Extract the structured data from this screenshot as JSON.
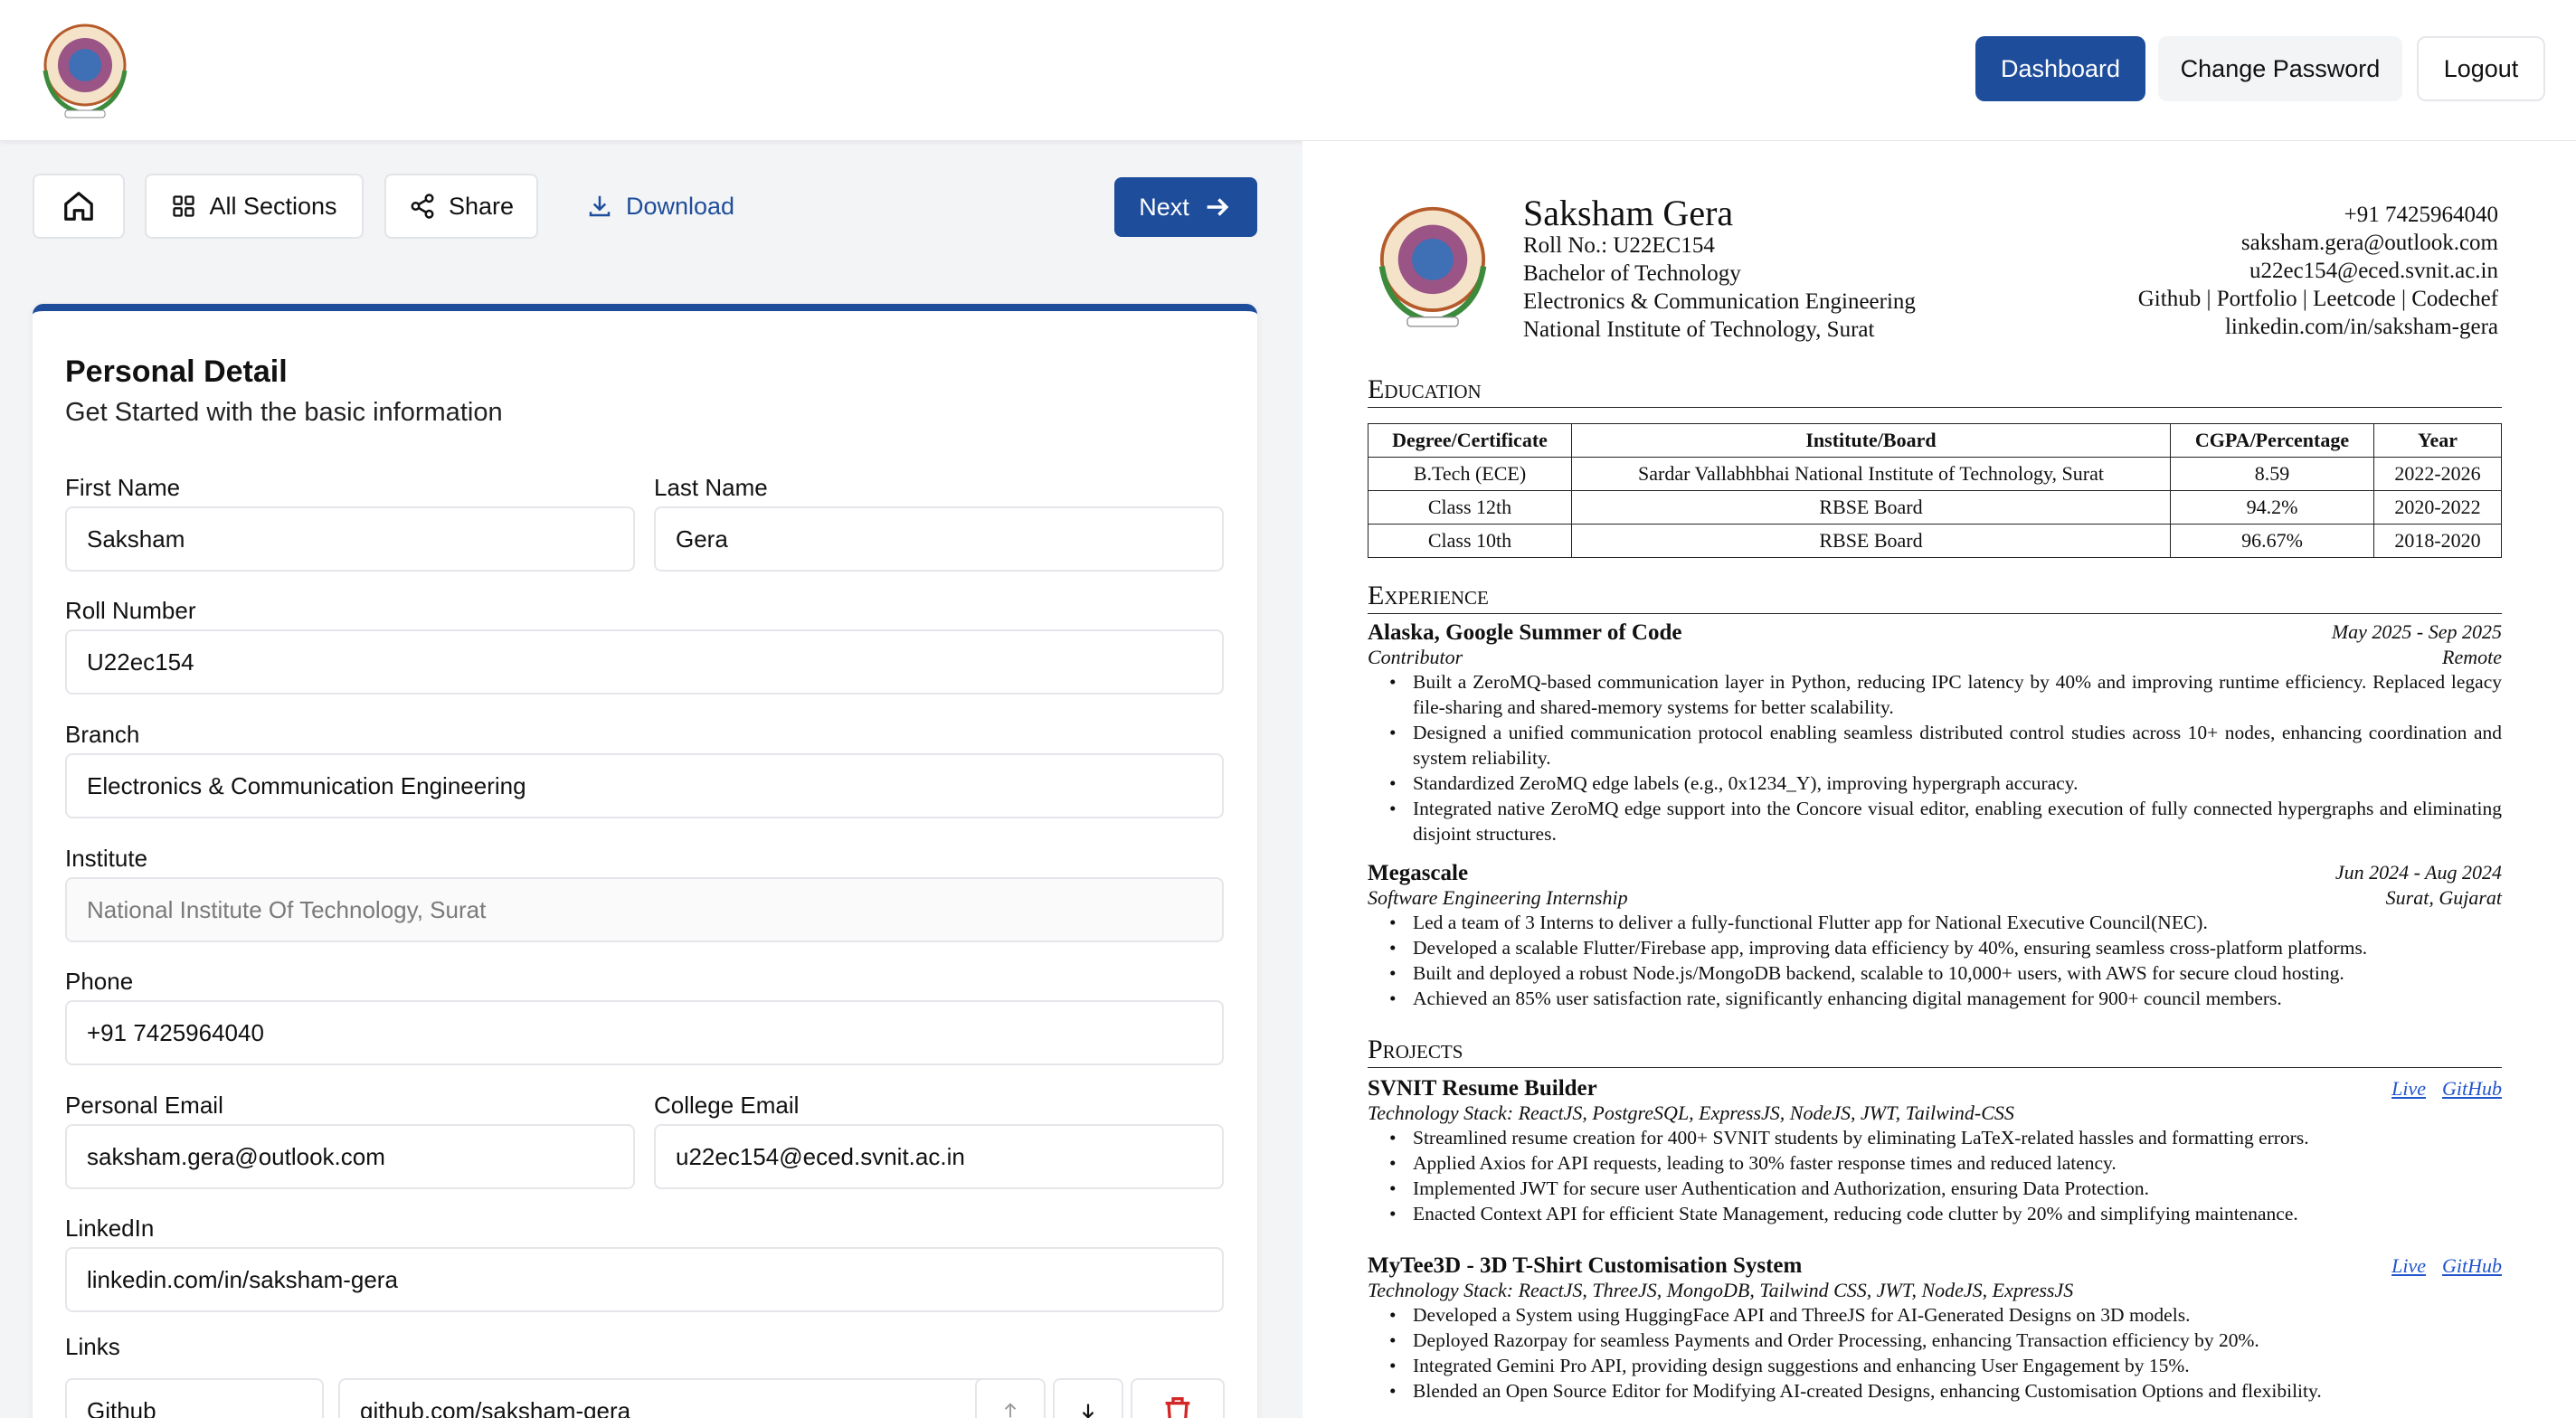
{
  "header": {
    "dashboard": "Dashboard",
    "change_password": "Change Password",
    "logout": "Logout"
  },
  "toolbar": {
    "all_sections": "All Sections",
    "share": "Share",
    "download": "Download",
    "next": "Next"
  },
  "form": {
    "title": "Personal Detail",
    "subtitle": "Get Started with the basic information",
    "first_name_label": "First Name",
    "first_name": "Saksham",
    "last_name_label": "Last Name",
    "last_name": "Gera",
    "roll_label": "Roll Number",
    "roll": "U22ec154",
    "branch_label": "Branch",
    "branch": "Electronics & Communication Engineering",
    "institute_label": "Institute",
    "institute": "National Institute Of Technology, Surat",
    "phone_label": "Phone",
    "phone": "+91 7425964040",
    "personal_email_label": "Personal Email",
    "personal_email": "saksham.gera@outlook.com",
    "college_email_label": "College Email",
    "college_email": "u22ec154@eced.svnit.ac.in",
    "linkedin_label": "LinkedIn",
    "linkedin": "linkedin.com/in/saksham-gera",
    "links_label": "Links",
    "link_name": "Github",
    "link_url": "github.com/saksham-gera"
  },
  "resume": {
    "name": "Saksham Gera",
    "roll": "Roll No.: U22EC154",
    "degree": "Bachelor of Technology",
    "branch": "Electronics & Communication Engineering",
    "institute": "National Institute of Technology, Surat",
    "phone": "+91 7425964040",
    "email": "saksham.gera@outlook.com",
    "college_email": "u22ec154@eced.svnit.ac.in",
    "profiles": "Github | Portfolio | Leetcode | Codechef",
    "linkedin": "linkedin.com/in/saksham-gera",
    "education_heading": "Education",
    "edu_headers": [
      "Degree/Certificate",
      "Institute/Board",
      "CGPA/Percentage",
      "Year"
    ],
    "edu_rows": [
      [
        "B.Tech (ECE)",
        "Sardar Vallabhbhai National Institute of Technology, Surat",
        "8.59",
        "2022-2026"
      ],
      [
        "Class 12th",
        "RBSE Board",
        "94.2%",
        "2020-2022"
      ],
      [
        "Class 10th",
        "RBSE Board",
        "96.67%",
        "2018-2020"
      ]
    ],
    "experience_heading": "Experience",
    "exp1": {
      "org": "Alaska, Google Summer of Code",
      "date": "May 2025 - Sep 2025",
      "role": "Contributor",
      "location": "Remote",
      "bullets": [
        "Built a ZeroMQ-based communication layer in Python, reducing IPC latency by 40% and improving runtime efficiency. Replaced legacy file-sharing and shared-memory systems for better scalability.",
        "Designed a unified communication protocol enabling seamless distributed control studies across 10+ nodes, enhancing coordination and system reliability.",
        "Standardized ZeroMQ edge labels (e.g., 0x1234_Y), improving hypergraph accuracy.",
        "Integrated native ZeroMQ edge support into the Concore visual editor, enabling execution of fully connected hypergraphs and eliminating disjoint structures."
      ]
    },
    "exp2": {
      "org": "Megascale",
      "date": "Jun 2024 - Aug 2024",
      "role": "Software Engineering Internship",
      "location": "Surat, Gujarat",
      "bullets": [
        "Led a team of 3 Interns to deliver a fully-functional Flutter app for National Executive Council(NEC).",
        "Developed a scalable Flutter/Firebase app, improving data efficiency by 40%, ensuring seamless cross-platform platforms.",
        "Built and deployed a robust Node.js/MongoDB backend, scalable to 10,000+ users, with AWS for secure cloud hosting.",
        "Achieved an 85% user satisfaction rate, significantly enhancing digital management for 900+ council members."
      ]
    },
    "projects_heading": "Projects",
    "live_label": "Live",
    "github_label": "GitHub",
    "proj1": {
      "name": "SVNIT Resume Builder",
      "stack": "Technology Stack: ReactJS, PostgreSQL, ExpressJS, NodeJS, JWT, Tailwind-CSS",
      "bullets": [
        "Streamlined resume creation for 400+ SVNIT students by eliminating LaTeX-related hassles and formatting errors.",
        "Applied Axios for API requests, leading to 30% faster response times and reduced latency.",
        "Implemented JWT for secure user Authentication and Authorization, ensuring Data Protection.",
        "Enacted Context API for efficient State Management, reducing code clutter by 20% and simplifying maintenance."
      ]
    },
    "proj2": {
      "name": "MyTee3D - 3D T-Shirt Customisation System",
      "stack": "Technology Stack: ReactJS, ThreeJS, MongoDB, Tailwind CSS, JWT, NodeJS, ExpressJS",
      "bullets": [
        "Developed a System using HuggingFace API and ThreeJS for AI-Generated Designs on 3D models.",
        "Deployed Razorpay for seamless Payments and Order Processing, enhancing Transaction efficiency by 20%.",
        "Integrated Gemini Pro API, providing design suggestions and enhancing User Engagement by 15%.",
        "Blended an Open Source Editor for Modifying AI-created Designs, enhancing Customisation Options and flexibility."
      ]
    }
  }
}
